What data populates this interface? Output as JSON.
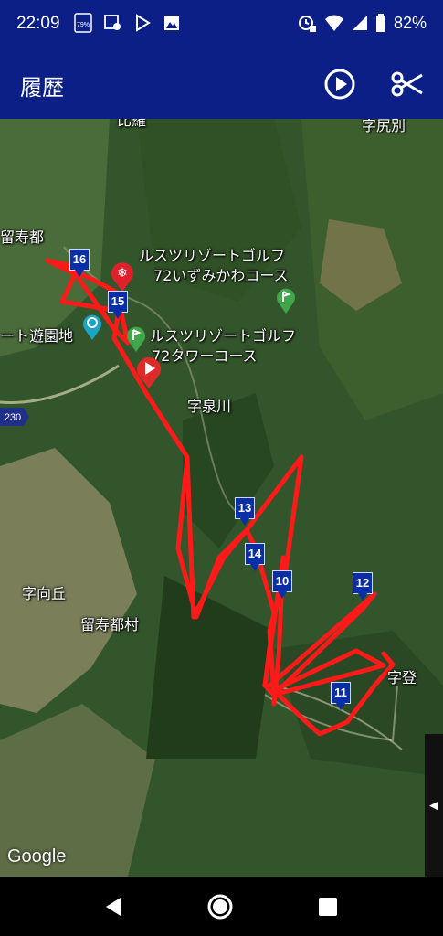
{
  "status_bar": {
    "time": "22:09",
    "battery_percent": "82%",
    "icons": [
      "sim-icon",
      "location-icon",
      "play-store-icon",
      "image-icon",
      "alarm-icon",
      "wifi-icon",
      "signal-icon",
      "battery-icon"
    ],
    "sim_label": "79%"
  },
  "app_bar": {
    "title": "履歴",
    "actions": [
      "play-icon",
      "scissors-icon"
    ]
  },
  "map": {
    "labels": {
      "top_left": "比羅",
      "top_right": "字尻別",
      "rusutsu": "留寿都",
      "golf_izumikawa_1": "ルスツリゾートゴルフ",
      "golf_izumikawa_2": "72いずみかわコース",
      "amusement": "ート遊園地",
      "golf_tower_1": "ルスツリゾートゴルフ",
      "golf_tower_2": "72タワーコース",
      "izumi_river": "字泉川",
      "route_230": "230",
      "mukaioka": "字向丘",
      "rusutsu_village": "留寿都村",
      "noboru": "字登"
    },
    "markers": [
      "16",
      "15",
      "13",
      "14",
      "10",
      "12",
      "11"
    ],
    "google": "Google",
    "colors": {
      "route": "#ff1a1a",
      "marker": "#0a2ea6",
      "header": "#0b1f86"
    }
  },
  "side_handle": {
    "glyph": "◀"
  }
}
